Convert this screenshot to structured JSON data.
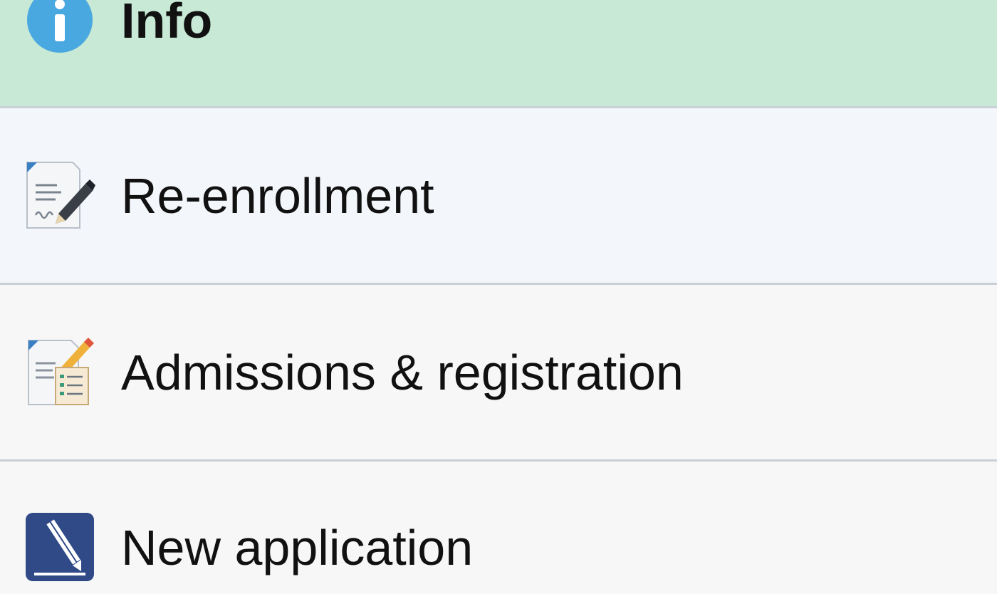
{
  "menu": {
    "items": [
      {
        "label": "Info",
        "icon": "info-icon",
        "selected": true,
        "accent": "#4aa8e0"
      },
      {
        "label": "Re-enrollment",
        "icon": "document-pen-icon"
      },
      {
        "label": "Admissions & registration",
        "icon": "checklist-form-icon"
      },
      {
        "label": "New application",
        "icon": "pencil-icon",
        "accent": "#2f4a86"
      }
    ],
    "selected_background": "#c7e9d5"
  }
}
